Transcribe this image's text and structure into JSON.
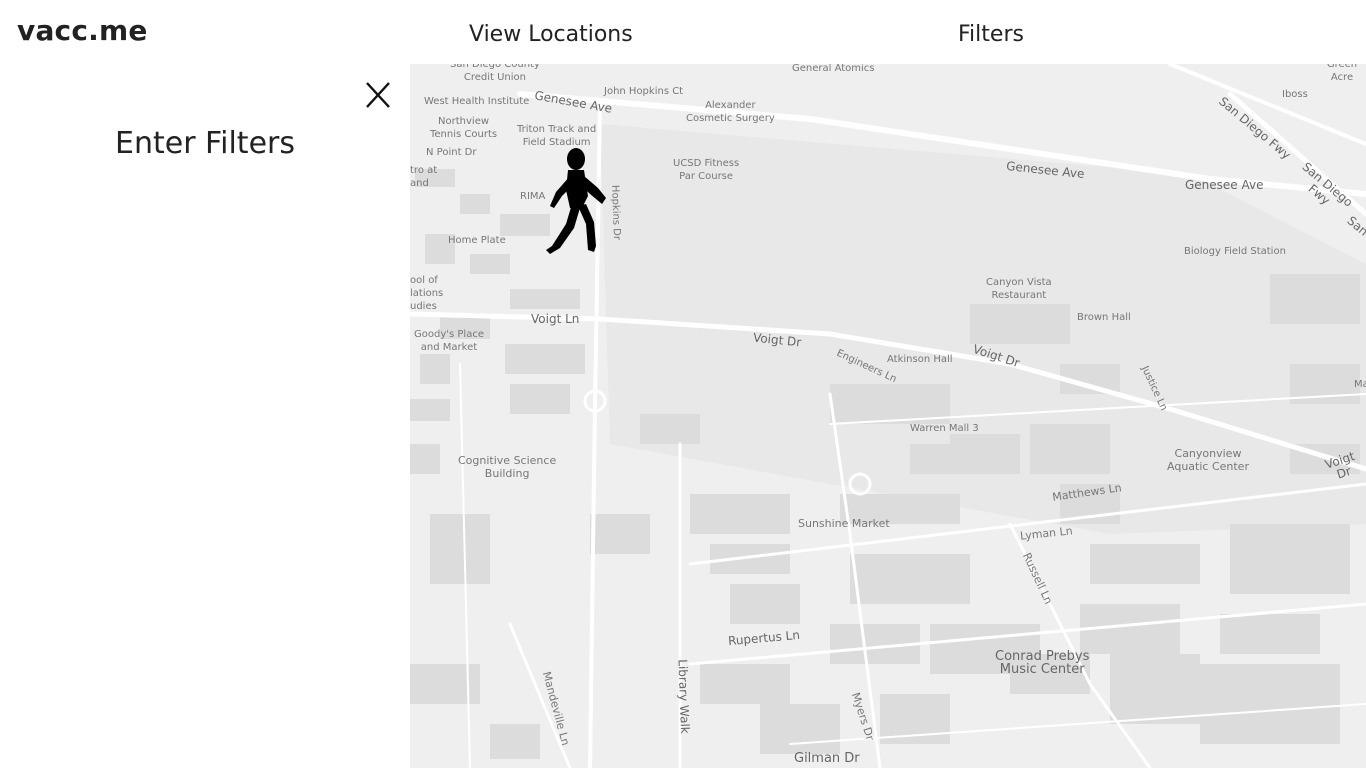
{
  "header": {
    "brand": "vacc.me",
    "nav_view_locations": "View Locations",
    "nav_filters": "Filters"
  },
  "filter_panel": {
    "close_label": "X",
    "heading": "Enter Filters"
  },
  "map": {
    "labels": {
      "san_diego_county_credit_union": "San Diego County\nCredit Union",
      "general_atomics": "General Atomics",
      "green_acre": "Green Acre",
      "iboss": "Iboss",
      "john_hopkins_ct": "John Hopkins Ct",
      "west_health_institute": "West Health Institute",
      "genesee_ave_1": "Genesee Ave",
      "alexander_cosmetic_surgery": "Alexander\nCosmetic Surgery",
      "northview_tennis_courts": "Northview\nTennis Courts",
      "triton_track": "Triton Track and\nField Stadium",
      "n_point_dr": "N Point Dr",
      "ucsd_fitness": "UCSD Fitness\nPar Course",
      "genesee_ave_2": "Genesee Ave",
      "genesee_ave_3": "Genesee Ave",
      "san_diego_fwy_1": "San Diego Fwy",
      "san_diego_fwy_2": "San Diego Fwy",
      "san_partial": "San",
      "tro_and": "tro at\nand",
      "rima": "RIMA",
      "hopkins_dr": "Hopkins Dr",
      "home_plate": "Home Plate",
      "biology_field_station": "Biology Field Station",
      "school_relations": "ool of\nlations\nudies",
      "canyon_vista": "Canyon Vista\nRestaurant",
      "voigt_ln": "Voigt Ln",
      "brown_hall": "Brown Hall",
      "goodys_place": "Goody's Place\nand Market",
      "voigt_dr_1": "Voigt Dr",
      "engineers_ln": "Engineers Ln",
      "atkinson_hall": "Atkinson Hall",
      "voigt_dr_2": "Voigt Dr",
      "justice_ln": "Justice Ln",
      "ma_partial": "Ma",
      "warren_mall": "Warren Mall 3",
      "cognitive_science": "Cognitive Science\nBuilding",
      "canyonview_aquatic": "Canyonview\nAquatic Center",
      "voigt_dr_3": "Voigt Dr",
      "matthews_ln": "Matthews Ln",
      "sunshine_market": "Sunshine Market",
      "lyman_ln": "Lyman Ln",
      "russell_ln": "Russell Ln",
      "rupertus_ln": "Rupertus Ln",
      "conrad_prebys": "Conrad Prebys\nMusic Center",
      "mandeville_ln": "Mandeville Ln",
      "library_walk": "Library Walk",
      "myers_dr": "Myers Dr",
      "gilman_dr": "Gilman Dr"
    }
  },
  "colors": {
    "map_background": "#efefef",
    "road": "#ffffff",
    "building": "#dcdcdc",
    "park": "#e6e7e6",
    "text": "#222222"
  },
  "icons": {
    "close": "close-icon",
    "user_location": "walking-person-icon"
  }
}
